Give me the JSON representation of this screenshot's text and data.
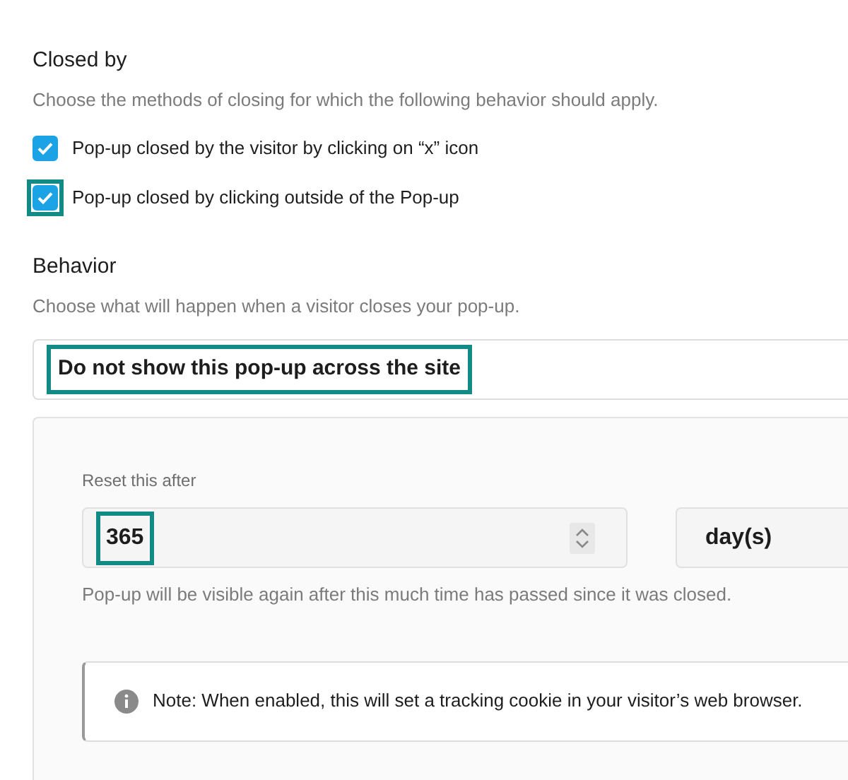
{
  "closed_by": {
    "title": "Closed by",
    "description": "Choose the methods of closing for which the following behavior should apply.",
    "options": [
      {
        "label": "Pop-up closed by the visitor by clicking on “x” icon",
        "checked": true,
        "highlighted": false
      },
      {
        "label": "Pop-up closed by clicking outside of the Pop-up",
        "checked": true,
        "highlighted": true
      }
    ]
  },
  "behavior": {
    "title": "Behavior",
    "description": "Choose what will happen when a visitor closes your pop-up.",
    "select": {
      "value": "Do not show this pop-up across the site",
      "highlighted": true
    },
    "reset": {
      "label": "Reset this after",
      "amount": {
        "value": "365",
        "highlighted": true
      },
      "unit": "day(s)",
      "help": "Pop-up will be visible again after this much time has passed since it was closed.",
      "note": "Note: When enabled, this will set a tracking cookie in your visitor’s web browser."
    }
  }
}
